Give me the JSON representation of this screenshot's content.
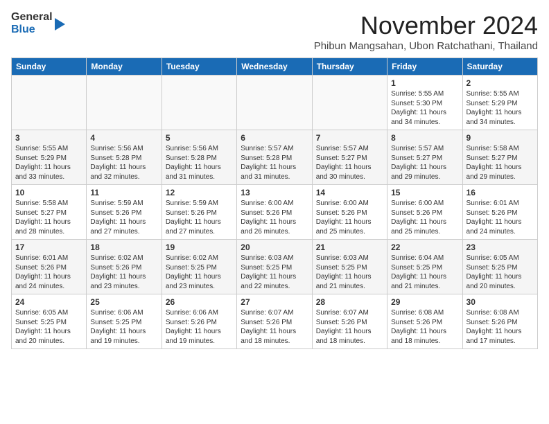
{
  "header": {
    "logo": {
      "general": "General",
      "blue": "Blue"
    },
    "month_title": "November 2024",
    "subtitle": "Phibun Mangsahan, Ubon Ratchathani, Thailand"
  },
  "calendar": {
    "days_of_week": [
      "Sunday",
      "Monday",
      "Tuesday",
      "Wednesday",
      "Thursday",
      "Friday",
      "Saturday"
    ],
    "weeks": [
      [
        {
          "day": "",
          "info": ""
        },
        {
          "day": "",
          "info": ""
        },
        {
          "day": "",
          "info": ""
        },
        {
          "day": "",
          "info": ""
        },
        {
          "day": "",
          "info": ""
        },
        {
          "day": "1",
          "info": "Sunrise: 5:55 AM\nSunset: 5:30 PM\nDaylight: 11 hours and 34 minutes."
        },
        {
          "day": "2",
          "info": "Sunrise: 5:55 AM\nSunset: 5:29 PM\nDaylight: 11 hours and 34 minutes."
        }
      ],
      [
        {
          "day": "3",
          "info": "Sunrise: 5:55 AM\nSunset: 5:29 PM\nDaylight: 11 hours and 33 minutes."
        },
        {
          "day": "4",
          "info": "Sunrise: 5:56 AM\nSunset: 5:28 PM\nDaylight: 11 hours and 32 minutes."
        },
        {
          "day": "5",
          "info": "Sunrise: 5:56 AM\nSunset: 5:28 PM\nDaylight: 11 hours and 31 minutes."
        },
        {
          "day": "6",
          "info": "Sunrise: 5:57 AM\nSunset: 5:28 PM\nDaylight: 11 hours and 31 minutes."
        },
        {
          "day": "7",
          "info": "Sunrise: 5:57 AM\nSunset: 5:27 PM\nDaylight: 11 hours and 30 minutes."
        },
        {
          "day": "8",
          "info": "Sunrise: 5:57 AM\nSunset: 5:27 PM\nDaylight: 11 hours and 29 minutes."
        },
        {
          "day": "9",
          "info": "Sunrise: 5:58 AM\nSunset: 5:27 PM\nDaylight: 11 hours and 29 minutes."
        }
      ],
      [
        {
          "day": "10",
          "info": "Sunrise: 5:58 AM\nSunset: 5:27 PM\nDaylight: 11 hours and 28 minutes."
        },
        {
          "day": "11",
          "info": "Sunrise: 5:59 AM\nSunset: 5:26 PM\nDaylight: 11 hours and 27 minutes."
        },
        {
          "day": "12",
          "info": "Sunrise: 5:59 AM\nSunset: 5:26 PM\nDaylight: 11 hours and 27 minutes."
        },
        {
          "day": "13",
          "info": "Sunrise: 6:00 AM\nSunset: 5:26 PM\nDaylight: 11 hours and 26 minutes."
        },
        {
          "day": "14",
          "info": "Sunrise: 6:00 AM\nSunset: 5:26 PM\nDaylight: 11 hours and 25 minutes."
        },
        {
          "day": "15",
          "info": "Sunrise: 6:00 AM\nSunset: 5:26 PM\nDaylight: 11 hours and 25 minutes."
        },
        {
          "day": "16",
          "info": "Sunrise: 6:01 AM\nSunset: 5:26 PM\nDaylight: 11 hours and 24 minutes."
        }
      ],
      [
        {
          "day": "17",
          "info": "Sunrise: 6:01 AM\nSunset: 5:26 PM\nDaylight: 11 hours and 24 minutes."
        },
        {
          "day": "18",
          "info": "Sunrise: 6:02 AM\nSunset: 5:26 PM\nDaylight: 11 hours and 23 minutes."
        },
        {
          "day": "19",
          "info": "Sunrise: 6:02 AM\nSunset: 5:25 PM\nDaylight: 11 hours and 23 minutes."
        },
        {
          "day": "20",
          "info": "Sunrise: 6:03 AM\nSunset: 5:25 PM\nDaylight: 11 hours and 22 minutes."
        },
        {
          "day": "21",
          "info": "Sunrise: 6:03 AM\nSunset: 5:25 PM\nDaylight: 11 hours and 21 minutes."
        },
        {
          "day": "22",
          "info": "Sunrise: 6:04 AM\nSunset: 5:25 PM\nDaylight: 11 hours and 21 minutes."
        },
        {
          "day": "23",
          "info": "Sunrise: 6:05 AM\nSunset: 5:25 PM\nDaylight: 11 hours and 20 minutes."
        }
      ],
      [
        {
          "day": "24",
          "info": "Sunrise: 6:05 AM\nSunset: 5:25 PM\nDaylight: 11 hours and 20 minutes."
        },
        {
          "day": "25",
          "info": "Sunrise: 6:06 AM\nSunset: 5:25 PM\nDaylight: 11 hours and 19 minutes."
        },
        {
          "day": "26",
          "info": "Sunrise: 6:06 AM\nSunset: 5:26 PM\nDaylight: 11 hours and 19 minutes."
        },
        {
          "day": "27",
          "info": "Sunrise: 6:07 AM\nSunset: 5:26 PM\nDaylight: 11 hours and 18 minutes."
        },
        {
          "day": "28",
          "info": "Sunrise: 6:07 AM\nSunset: 5:26 PM\nDaylight: 11 hours and 18 minutes."
        },
        {
          "day": "29",
          "info": "Sunrise: 6:08 AM\nSunset: 5:26 PM\nDaylight: 11 hours and 18 minutes."
        },
        {
          "day": "30",
          "info": "Sunrise: 6:08 AM\nSunset: 5:26 PM\nDaylight: 11 hours and 17 minutes."
        }
      ]
    ]
  }
}
